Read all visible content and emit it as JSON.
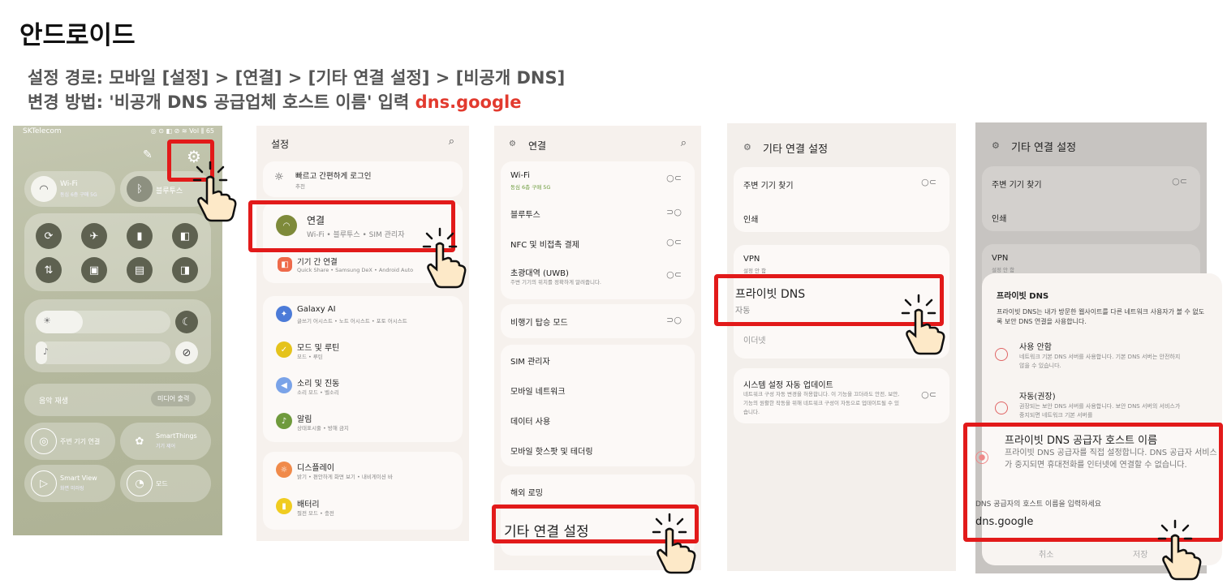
{
  "header": {
    "title": "안드로이드",
    "path_label": "설정 경로:  모바일 [설정] > [연결] > [기타 연결 설정] > [비공개 DNS]",
    "method_label": "변경 방법: '비공개 DNS 공급업체 호스트 이름' 입력",
    "method_value": "dns.google"
  },
  "colors": {
    "highlight": "#e21a1a",
    "accent_text": "#e23a2e"
  },
  "panel1": {
    "carrier": "SKTelecom",
    "status_right": "◎ ⊙ ◧ ⊘ ≋ Vol ⫼ 65",
    "wifi": {
      "label": "Wi-Fi",
      "sub": "동심 6층 구매 5G"
    },
    "bluetooth": {
      "label": "블루투스"
    },
    "media": {
      "label": "음악 재생",
      "button": "미디어 출력"
    },
    "nearby": {
      "label": "주변 기기 연결"
    },
    "smartthings": {
      "label": "SmartThings",
      "sub": "기기 제어"
    },
    "smartview": {
      "label": "Smart View",
      "sub": "화면 미러링"
    },
    "mode": {
      "label": "모드"
    }
  },
  "panel2": {
    "title": "설정",
    "items": [
      {
        "title": "빠르고 간편하게 로그인",
        "sub": "추천"
      },
      {
        "title": "연결",
        "sub": "Wi-Fi • 블루투스 • SIM 관리자"
      },
      {
        "title": "기기 간 연결",
        "sub": "Quick Share • Samsung DeX • Android Auto"
      },
      {
        "title": "Galaxy AI",
        "sub": "글쓰기 어시스트 • 노트 어시스트 • 포토 어시스트"
      },
      {
        "title": "모드 및 루틴",
        "sub": "모드 • 루틴"
      },
      {
        "title": "소리 및 진동",
        "sub": "소리 모드 • 벨소리"
      },
      {
        "title": "알림",
        "sub": "상태표시줄 • 방해 금지"
      },
      {
        "title": "디스플레이",
        "sub": "밝기 • 편안하게 화면 보기 • 내비게이션 바"
      },
      {
        "title": "배터리",
        "sub": "절전 모드 • 충전"
      }
    ]
  },
  "panel3": {
    "title": "연결",
    "items": [
      {
        "title": "Wi-Fi",
        "sub": "동심 6층 구매 5G"
      },
      {
        "title": "블루투스",
        "sub": ""
      },
      {
        "title": "NFC 및 비접촉 결제",
        "sub": ""
      },
      {
        "title": "초광대역 (UWB)",
        "sub": "주변 기기의 위치를 정확하게 알려줍니다."
      },
      {
        "title": "비행기 탑승 모드",
        "sub": ""
      },
      {
        "title": "SIM 관리자",
        "sub": ""
      },
      {
        "title": "모바일 네트워크",
        "sub": ""
      },
      {
        "title": "데이터 사용",
        "sub": ""
      },
      {
        "title": "모바일 핫스팟 및 테더링",
        "sub": ""
      },
      {
        "title": "해외 로밍",
        "sub": ""
      },
      {
        "title": "기타 연결 설정",
        "sub": ""
      }
    ]
  },
  "panel4": {
    "title": "기타 연결 설정",
    "items": [
      {
        "title": "주변 기기 찾기",
        "sub": ""
      },
      {
        "title": "인쇄",
        "sub": ""
      },
      {
        "title": "VPN",
        "sub": "설정 안 함"
      },
      {
        "title": "프라이빗 DNS",
        "sub": "자동"
      },
      {
        "title": "이더넷",
        "sub": ""
      },
      {
        "title": "시스템 설정 자동 업데이트",
        "sub": "네트워크 구성 자동 변경을 허용합니다. 이 기능을 끄더라도 안전, 보안, 기능의 원활한 작동을 위해 네트워크 구성이 자동으로 업데이트될 수 있습니다."
      }
    ]
  },
  "panel5": {
    "title": "기타 연결 설정",
    "bg_items": [
      {
        "title": "주변 기기 찾기"
      },
      {
        "title": "인쇄"
      },
      {
        "title": "VPN",
        "sub": "설정 안 함"
      }
    ],
    "dialog": {
      "title": "프라이빗 DNS",
      "desc": "프라이빗 DNS는 내가 방문한 웹사이트를 다른 네트워크 사용자가 볼 수 없도록 보안 DNS 연결을 사용합니다.",
      "options": [
        {
          "label": "사용 안함",
          "desc": "네트워크 기본 DNS 서버를 사용합니다. 기본 DNS 서버는 안전하지 않을 수 있습니다."
        },
        {
          "label": "자동(권장)",
          "desc": "권장되는 보안 DNS 서버를 사용합니다. 보안 DNS 서버의 서비스가 중지되면 네트워크 기본 서버를"
        },
        {
          "label": "프라이빗 DNS 공급자 호스트 이름",
          "desc": "프라이빗 DNS 공급자를 직접 설정합니다. DNS 공급자 서비스가 중지되면 휴대전화를 인터넷에 연결할 수 없습니다."
        }
      ],
      "hostname_label": "DNS 공급자의 호스트 이름을 입력하세요",
      "hostname_value": "dns.google",
      "cancel": "취소",
      "save": "저장"
    }
  }
}
